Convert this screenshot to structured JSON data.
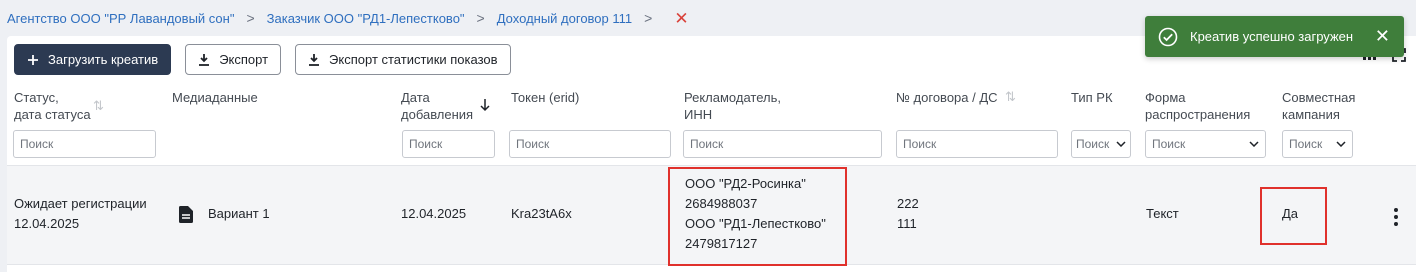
{
  "breadcrumb": {
    "items": [
      "Агентство ООО \"РР Лавандовый сон\"",
      "Заказчик ООО \"РД1-Лепестково\"",
      "Доходный договор 111"
    ],
    "separator": ">",
    "close_glyph": "✕"
  },
  "toolbar": {
    "upload_label": "Загрузить креатив",
    "export_label": "Экспорт",
    "export_stats_label": "Экспорт статистики показов"
  },
  "toast": {
    "message": "Креатив успешно загружен",
    "close_glyph": "✕",
    "color": "#3f7e3b"
  },
  "table": {
    "headers": {
      "status_line1": "Статус,",
      "status_line2": "дата статуса",
      "media": "Медиаданные",
      "date_line1": "Дата",
      "date_line2": "добавления",
      "token": "Токен (erid)",
      "advertiser_line1": "Рекламодатель,",
      "advertiser_line2": "ИНН",
      "contract": "№ договора / ДС",
      "rk_type": "Тип РК",
      "form_line1": "Форма",
      "form_line2": "распространения",
      "joint_line1": "Совместная",
      "joint_line2": "кампания"
    },
    "filter_placeholder": "Поиск",
    "row": {
      "status": "Ожидает регистрации",
      "status_date": "12.04.2025",
      "media": "Вариант 1",
      "date_added": "12.04.2025",
      "token": "Kra23tA6x",
      "advertisers": [
        "ООО \"РД2-Росинка\"",
        "2684988037",
        "ООО \"РД1-Лепестково\"",
        "2479817127"
      ],
      "contracts": [
        "222",
        "111"
      ],
      "form": "Текст",
      "joint": "Да"
    }
  },
  "colors": {
    "highlight": "#e0312c",
    "primary_button": "#2c3a52",
    "link": "#2f6fbf"
  }
}
